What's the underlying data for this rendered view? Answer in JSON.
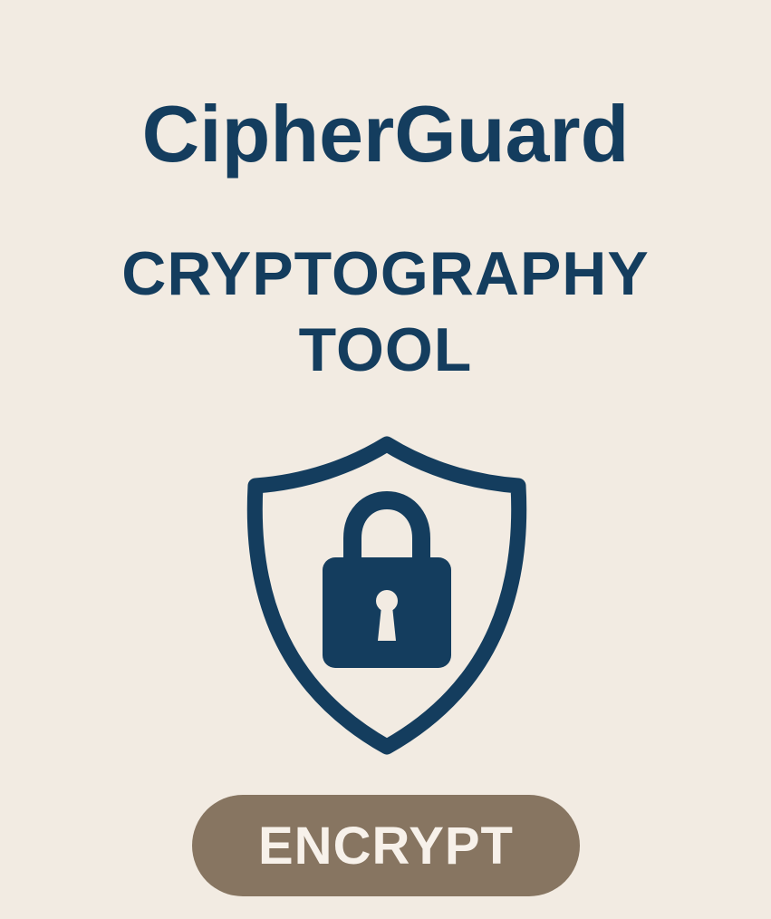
{
  "app": {
    "title": "CipherGuard",
    "subtitle_line1": "CRYPTOGRAPHY",
    "subtitle_line2": "TOOL"
  },
  "icons": {
    "emblem": "shield-lock-icon"
  },
  "actions": {
    "encrypt_label": "ENCRYPT"
  },
  "colors": {
    "background": "#f2ebe2",
    "primary": "#143d5e",
    "button": "#877561",
    "button_text": "#f7f1ea"
  }
}
